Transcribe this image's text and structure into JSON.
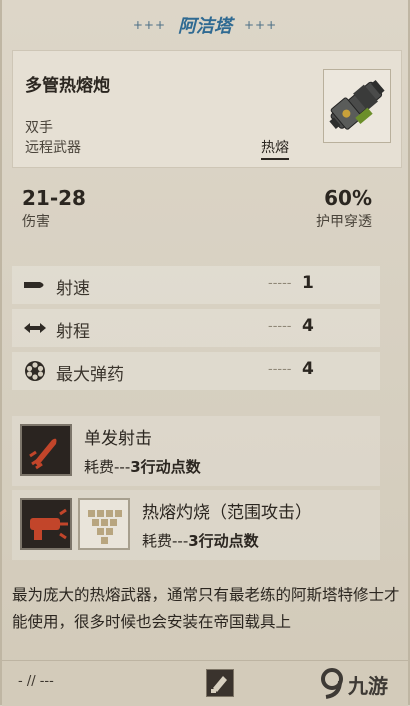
{
  "header": {
    "deco_left": "+++",
    "character": "阿洁塔",
    "deco_right": "+++"
  },
  "weapon": {
    "name": "多管热熔炮",
    "handedness": "双手",
    "type": "远程武器",
    "tag": "热熔",
    "art_icon": "multi-melta-weapon-icon"
  },
  "stats": {
    "damage_value": "21-28",
    "damage_label": "伤害",
    "pierce_value": "60%",
    "pierce_label": "护甲穿透"
  },
  "properties": [
    {
      "icon": "bullet-icon",
      "label": "射速",
      "dash": "-----",
      "value": "1"
    },
    {
      "icon": "range-arrows-icon",
      "label": "射程",
      "dash": "-----",
      "value": "4"
    },
    {
      "icon": "ammo-cylinder-icon",
      "label": "最大弹药",
      "dash": "-----",
      "value": "4"
    }
  ],
  "abilities": [
    {
      "icon": "single-shot-icon",
      "name": "单发射击",
      "cost_prefix": "耗费---",
      "cost": "3行动点数"
    },
    {
      "icon": "melta-burn-icon",
      "area_icon": "area-pattern-icon",
      "name": "热熔灼烧（范围攻击）",
      "cost_prefix": "耗费---",
      "cost": "3行动点数"
    }
  ],
  "description": "最为庞大的热熔武器，通常只有最老练的阿斯塔特修士才能使用，很多时候也会安装在帝国载具上",
  "footer": {
    "text": "- // ---",
    "icon": "weapon-slot-icon"
  },
  "watermark": {
    "text": "九游"
  },
  "colors": {
    "accent": "#2f6a92",
    "icon_red": "#c2452a",
    "panel": "#e6e0d4"
  }
}
